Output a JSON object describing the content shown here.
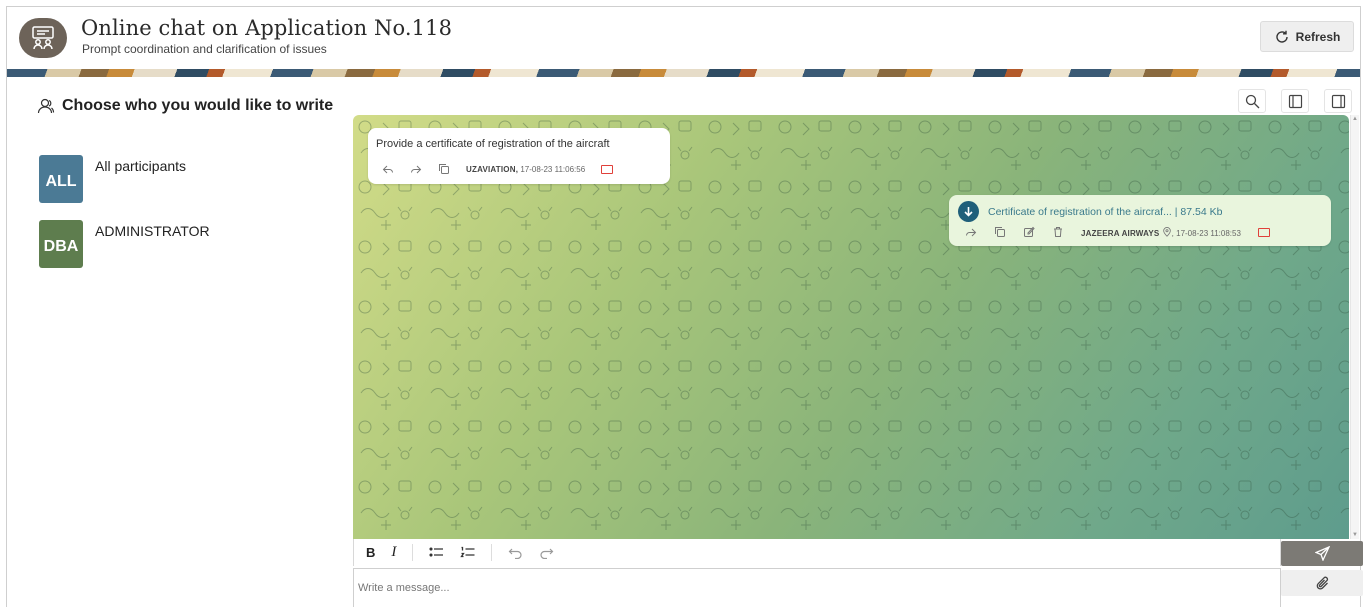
{
  "header": {
    "title": "Online chat on Application No.118",
    "subtitle": "Prompt coordination and clarification of issues",
    "refresh_label": "Refresh",
    "app_icon": "chat-users-icon"
  },
  "participants_panel": {
    "heading": "Choose who you would like to write",
    "heading_icon": "user-icon",
    "items": [
      {
        "badge": "ALL",
        "name": "All participants",
        "color": "#4b7a95"
      },
      {
        "badge": "DBA",
        "name": "ADMINISTRATOR",
        "color": "#5e7d4e"
      }
    ]
  },
  "chat_toolbar": {
    "icons": [
      "search-icon",
      "panel-left-icon",
      "panel-right-icon"
    ]
  },
  "messages": [
    {
      "direction": "incoming",
      "text": "Provide a certificate of registration of the aircraft",
      "author": "UZAVIATION,",
      "time": "17-08-23 11:06:56",
      "actions": [
        "reply-icon",
        "forward-icon",
        "copy-icon"
      ]
    },
    {
      "direction": "outgoing",
      "file_name": "Certificate of registration of the aircraf...",
      "file_size": "| 87.54 Kb",
      "author": "JAZEERA AIRWAYS",
      "time": ", 17-08-23 11:08:53",
      "actions": [
        "forward-icon",
        "copy-icon",
        "edit-icon",
        "delete-icon",
        "location-icon"
      ]
    }
  ],
  "editor": {
    "bold_label": "B",
    "italic_label": "I",
    "placeholder": "Write a message...",
    "icons": [
      "bullet-list-icon",
      "numbered-list-icon",
      "undo-icon",
      "redo-icon",
      "send-icon",
      "attach-icon"
    ]
  },
  "colors": {
    "chat_gradient_start": "#d2dc88",
    "chat_gradient_end": "#5e9c8d",
    "outgoing_bubble": "#e9f5dd",
    "download_icon": "#1f5f7a",
    "send_button": "#7c7a75"
  }
}
